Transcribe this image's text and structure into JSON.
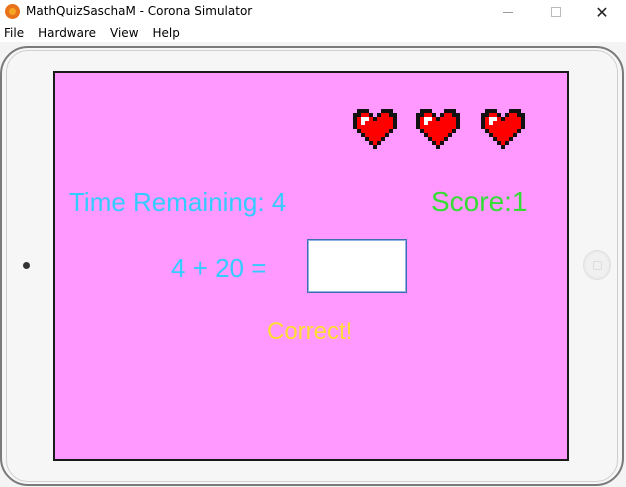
{
  "window": {
    "title": "MathQuizSaschaM - Corona Simulator",
    "close_glyph": "✕"
  },
  "menu": {
    "items": [
      "File",
      "Hardware",
      "View",
      "Help"
    ]
  },
  "game": {
    "lives": 3,
    "heart_icon": "pixel-heart-icon",
    "time_text": "Time Remaining: 4",
    "score_text": "Score:1",
    "question_text": "4 + 20 =",
    "answer_value": "",
    "feedback_text": "Correct!"
  },
  "colors": {
    "screen_background": "#ff99ff",
    "time": "#33ccff",
    "score": "#33dd33",
    "feedback": "#ffdd33",
    "heart": "#ff0000"
  }
}
